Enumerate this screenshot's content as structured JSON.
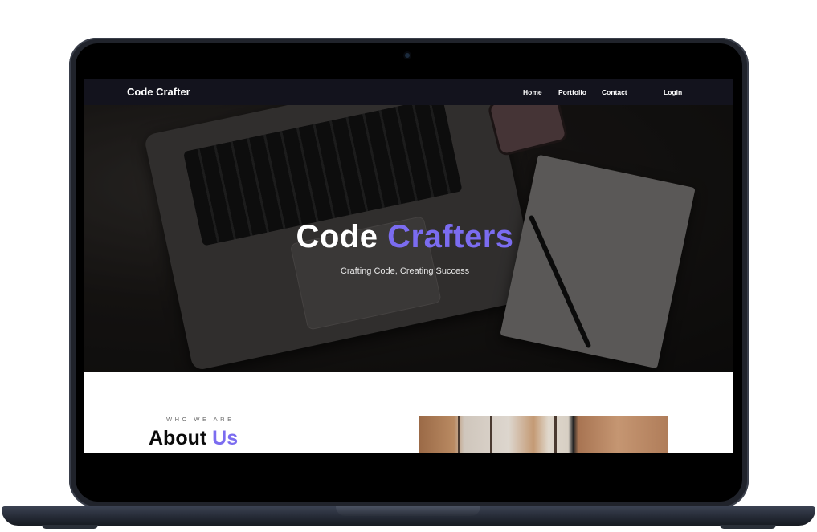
{
  "navbar": {
    "brand": "Code Crafter",
    "links": [
      {
        "label": "Home"
      },
      {
        "label": "Portfolio"
      },
      {
        "label": "Contact"
      },
      {
        "label": "Login"
      }
    ]
  },
  "hero": {
    "title_main": "Code",
    "title_accent": "Crafters",
    "subtitle": "Crafting Code, Creating Success"
  },
  "about": {
    "eyebrow": "WHO WE ARE",
    "heading_main": "About",
    "heading_accent": "Us"
  },
  "colors": {
    "accent": "#7b6cf0",
    "navbar_bg": "#13131d",
    "laptop_frame": "#20232b"
  }
}
